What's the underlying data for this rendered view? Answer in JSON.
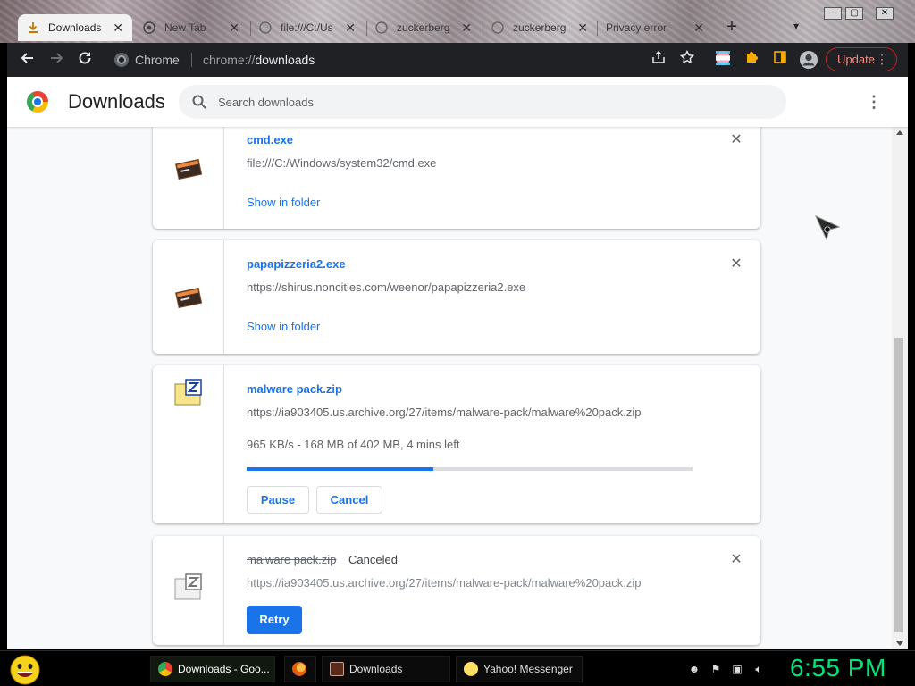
{
  "tabs": [
    {
      "title": "Downloads",
      "icon": "download-icon",
      "active": true
    },
    {
      "title": "New Tab",
      "icon": "chrome-icon"
    },
    {
      "title": "file:///C:/Us",
      "icon": "globe-icon"
    },
    {
      "title": "zuckerberg",
      "icon": "globe-icon"
    },
    {
      "title": "zuckerberg",
      "icon": "globe-icon"
    },
    {
      "title": "Privacy error",
      "icon": "warning-icon"
    }
  ],
  "toolbar": {
    "chip_label": "Chrome",
    "url_scheme": "chrome://",
    "url_host": "downloads",
    "update_label": "Update"
  },
  "header": {
    "title": "Downloads",
    "search_placeholder": "Search downloads"
  },
  "downloads": [
    {
      "name": "cmd.exe",
      "url": "file:///C:/Windows/system32/cmd.exe",
      "action": "Show in folder",
      "icon": "exe-icon"
    },
    {
      "name": "papapizzeria2.exe",
      "url": "https://shirus.noncities.com/weenor/papapizzeria2.exe",
      "action": "Show in folder",
      "icon": "exe-icon"
    },
    {
      "name": "malware pack.zip",
      "url": "https://ia903405.us.archive.org/27/items/malware-pack/malware%20pack.zip",
      "progress_text": "965 KB/s - 168 MB of 402 MB, 4 mins left",
      "progress": 0.418,
      "pause_label": "Pause",
      "cancel_label": "Cancel",
      "icon": "zip-icon"
    },
    {
      "name": "malware pack.zip",
      "status": "Canceled",
      "url": "https://ia903405.us.archive.org/27/items/malware-pack/malware%20pack.zip",
      "retry_label": "Retry",
      "icon": "zip-icon"
    }
  ],
  "taskbar": {
    "items": [
      {
        "label": "Downloads - Goo...",
        "icon": "chrome-icon",
        "active": true
      },
      {
        "label": "",
        "icon": "firefox-icon"
      },
      {
        "label": "Downloads",
        "icon": "folder-icon"
      },
      {
        "label": "Yahoo! Messenger",
        "icon": "yahoo-messenger-icon"
      }
    ],
    "clock": "6:55 PM"
  },
  "colors": {
    "accent": "#1a73e8",
    "update": "#f28b82",
    "clock": "#00e676"
  }
}
